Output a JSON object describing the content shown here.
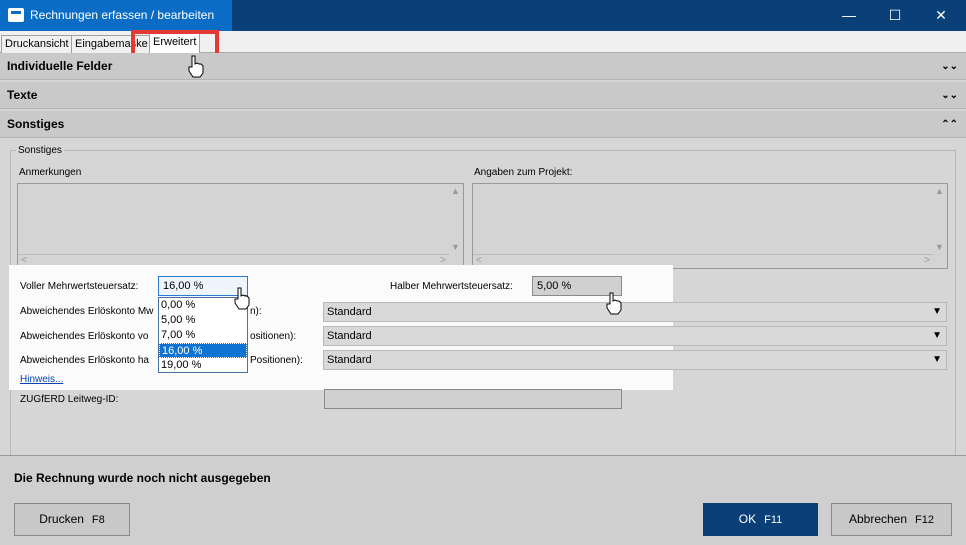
{
  "window": {
    "title": "Rechnungen erfassen / bearbeiten",
    "minimize": "—",
    "maximize": "☐",
    "close": "✕"
  },
  "tabs": [
    {
      "label": "Druckansicht"
    },
    {
      "label": "Eingabemaske"
    },
    {
      "label": "Erweitert"
    }
  ],
  "sections": [
    {
      "label": "Individuelle Felder",
      "chevron": "⌄⌄"
    },
    {
      "label": "Texte",
      "chevron": "⌄⌄"
    },
    {
      "label": "Sonstiges",
      "chevron": "⌃⌃"
    }
  ],
  "group": {
    "title": "Sonstiges",
    "anmerkungen_label": "Anmerkungen",
    "projekt_label": "Angaben zum Projekt:",
    "voller_label": "Voller Mehrwertsteuersatz:",
    "voller_value": "16,00 %",
    "halber_label": "Halber Mehrwertsteuersatz:",
    "halber_value": "5,00 %",
    "erloes1_label": "Abweichendes Erlöskonto Mw",
    "erloes1_suffix": "n):",
    "erloes2_label": "Abweichendes Erlöskonto vo",
    "erloes2_suffix": "ositionen):",
    "erloes3_label": "Abweichendes Erlöskonto ha",
    "erloes3_suffix": "Positionen):",
    "combo_value": "Standard",
    "hinweis": "Hinweis...",
    "zugferd_label": "ZUGfERD Leitweg-ID:",
    "zugferd_value": ""
  },
  "dropdown": {
    "options": [
      "0,00 %",
      "5,00 %",
      "7,00 %",
      "16,00 %",
      "19,00 %"
    ],
    "selected": "16,00 %"
  },
  "status": {
    "text": "Die Rechnung wurde noch nicht ausgegeben"
  },
  "buttons": {
    "drucken": {
      "label": "Drucken",
      "key": "F8"
    },
    "ok": {
      "label": "OK",
      "key": "F11"
    },
    "abbrechen": {
      "label": "Abbrechen",
      "key": "F12"
    }
  },
  "colors": {
    "titlebar": "#0a6cc4",
    "primary": "#0b3f78",
    "highlight": "#e53935"
  }
}
